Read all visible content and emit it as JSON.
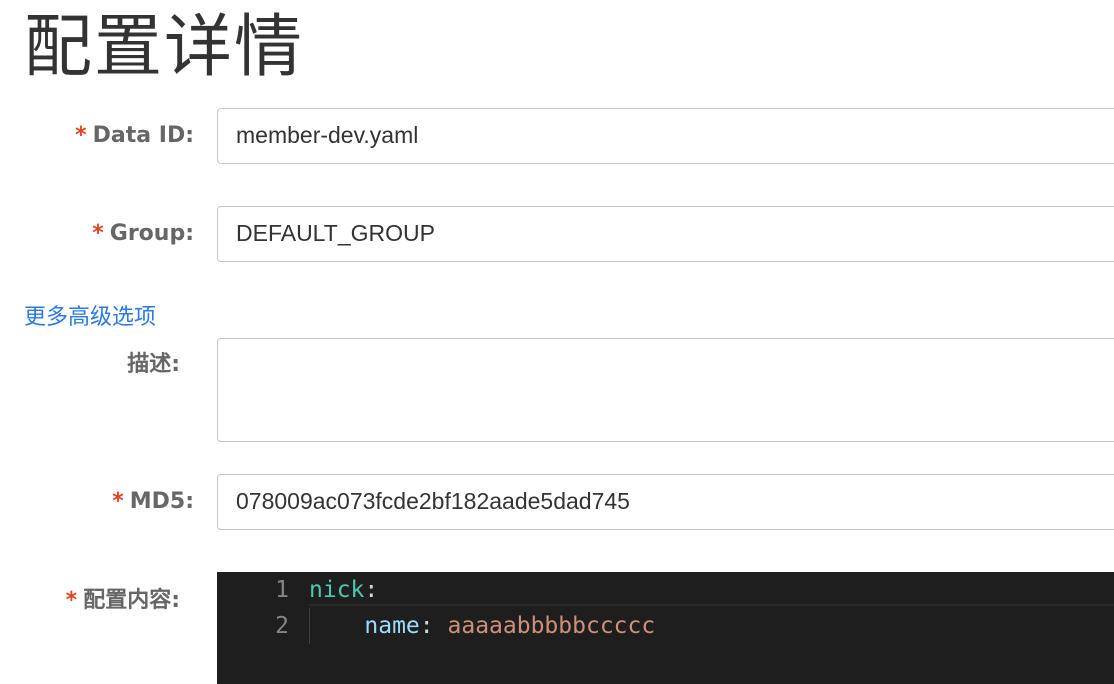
{
  "page": {
    "title": "配置详情"
  },
  "form": {
    "data_id": {
      "required_mark": "*",
      "label": "Data ID:",
      "value": "member-dev.yaml"
    },
    "group": {
      "required_mark": "*",
      "label": "Group:",
      "value": "DEFAULT_GROUP"
    },
    "more_options_link": "更多高级选项",
    "description": {
      "label": "描述:",
      "value": ""
    },
    "md5": {
      "required_mark": "*",
      "label": "MD5:",
      "value": "078009ac073fcde2bf182aade5dad745"
    },
    "content": {
      "required_mark": "*",
      "label": "配置内容:"
    }
  },
  "editor": {
    "lines": [
      {
        "number": "1",
        "key": "nick",
        "colon": ":",
        "value": ""
      },
      {
        "number": "2",
        "indent": "    ",
        "key": "name",
        "colon": ":",
        "value": "aaaaabbbbbccccc"
      }
    ]
  },
  "colors": {
    "required": "#e0431f",
    "link": "#2a7ae2",
    "editor_bg": "#1e1e1e",
    "yaml_key": "#4ec9b0",
    "yaml_string": "#ce9178"
  }
}
